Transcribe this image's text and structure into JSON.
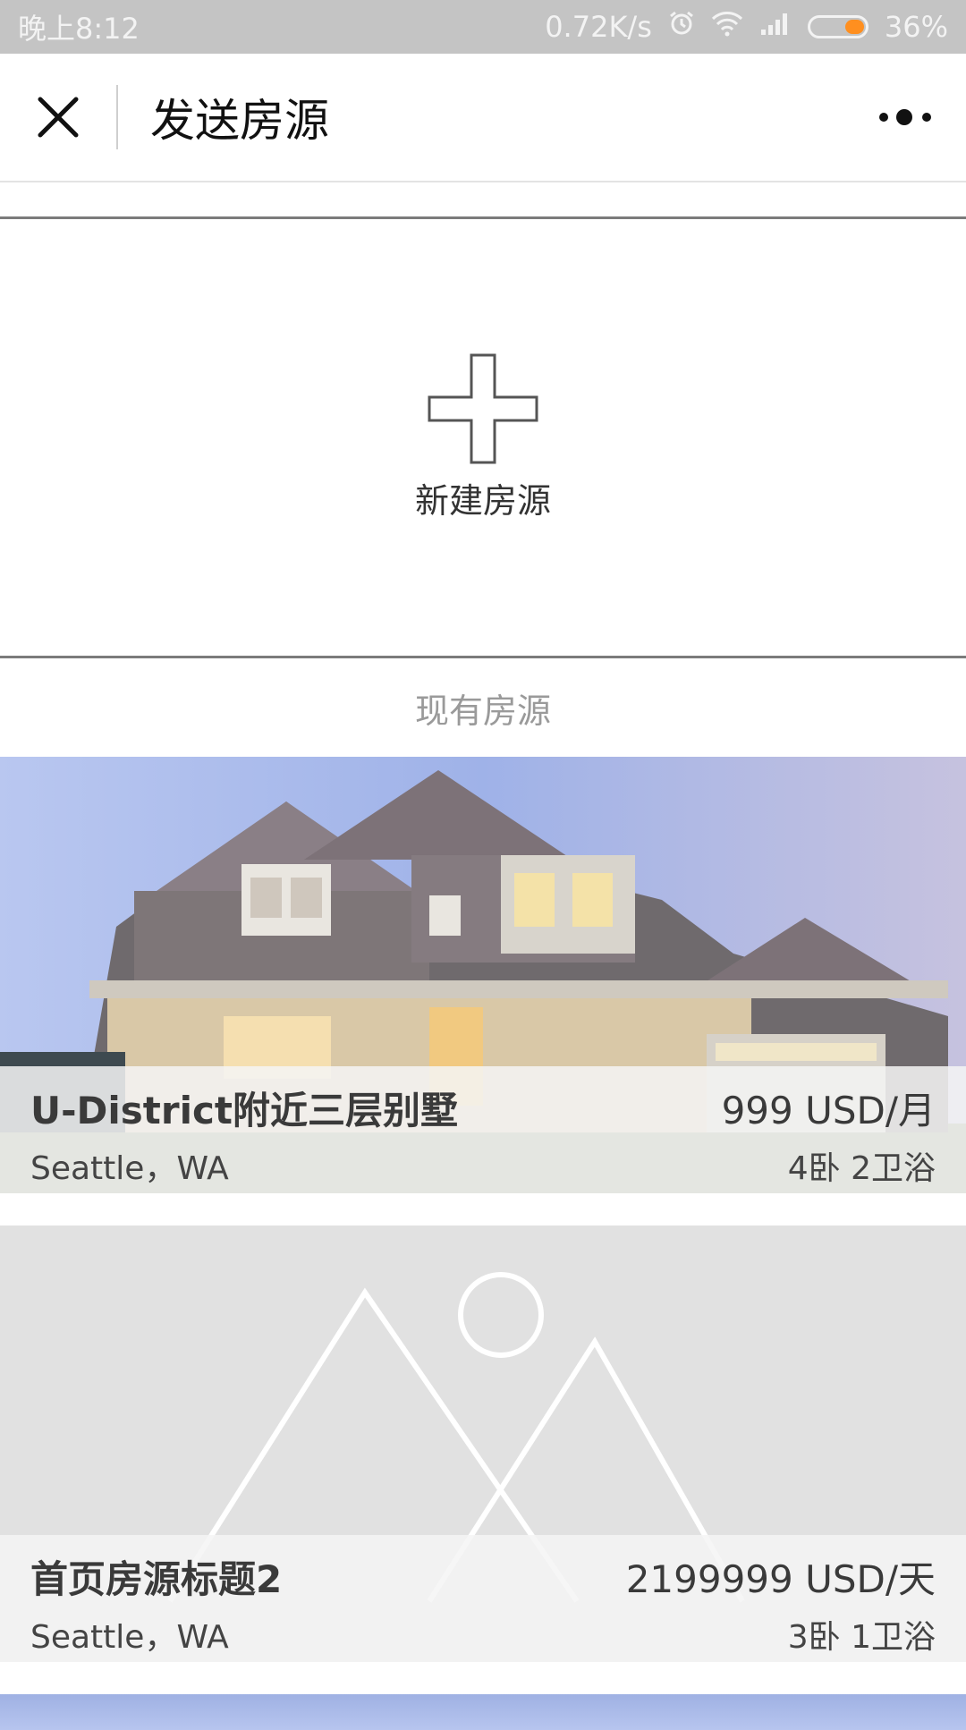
{
  "status_bar": {
    "time": "晚上8:12",
    "network_speed": "0.72K/s",
    "battery": "36%",
    "battery_level": 0.36,
    "icons": [
      "alarm-icon",
      "wifi-icon",
      "signal-icon",
      "battery-icon"
    ]
  },
  "nav": {
    "title": "发送房源",
    "close_icon": "close-icon",
    "more_icon": "more-icon"
  },
  "new_listing": {
    "label": "新建房源",
    "icon": "plus-icon"
  },
  "existing": {
    "title": "现有房源",
    "listings": [
      {
        "title": "U-District附近三层别墅",
        "location": "Seattle，WA",
        "price": "999 USD/月",
        "rooms": "4卧 2卫浴",
        "image": "house-photo"
      },
      {
        "title": "首页房源标题2",
        "location": "Seattle，WA",
        "price": "2199999 USD/天",
        "rooms": "3卧 1卫浴",
        "image": "image-placeholder-icon"
      }
    ]
  },
  "colors": {
    "status_bar_bg": "#c4c4c4",
    "battery_accent": "#ff8f1f",
    "placeholder_bg": "#e1e1e1"
  }
}
